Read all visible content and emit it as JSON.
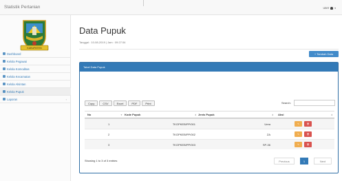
{
  "app": {
    "brand": "Statistik Pertanian",
    "user": "user",
    "user_caret": "▾"
  },
  "sidebar": {
    "logo_text": "KABUPATEN",
    "items": [
      {
        "label": "Dashboard",
        "icon": "dashboard-icon"
      },
      {
        "label": "Kelola Pegawai",
        "icon": "user-icon"
      },
      {
        "label": "Kelola Komoditas",
        "icon": "leaf-icon"
      },
      {
        "label": "Kelola Kecamatan",
        "icon": "building-icon"
      },
      {
        "label": "Kelola Alsintan",
        "icon": "wrench-icon"
      },
      {
        "label": "Kelola Pupuk",
        "icon": "flask-icon"
      },
      {
        "label": "Laporan",
        "icon": "file-icon",
        "arrow": "‹"
      }
    ]
  },
  "page": {
    "title": "Data Pupuk",
    "datetime": "Tanggal : 10-08-2019 | Jam : 09:27:54",
    "add_button": "Tambah Data"
  },
  "panel": {
    "heading": "Tabel Data Pupuk",
    "tools": [
      "Copy",
      "CSV",
      "Excel",
      "PDF",
      "Print"
    ],
    "search_label": "Search:",
    "search_value": "",
    "columns": [
      "No",
      "Kode Pupuk",
      "Jenis Pupuk",
      "Aksi"
    ],
    "rows": [
      {
        "no": "1",
        "kode": "TKOPKEB/PP/001",
        "jenis": "Urea"
      },
      {
        "no": "2",
        "kode": "TKOPKEB/PP/002",
        "jenis": "ZA"
      },
      {
        "no": "3",
        "kode": "TKOPKEB/PP/003",
        "jenis": "SP-36"
      }
    ],
    "info": "Showing 1 to 3 of 3 entries",
    "pager": {
      "prev": "Previous",
      "page": "1",
      "next": "Next"
    }
  },
  "colors": {
    "primary": "#337ab7",
    "warning": "#f0ad4e",
    "danger": "#d9534f"
  }
}
